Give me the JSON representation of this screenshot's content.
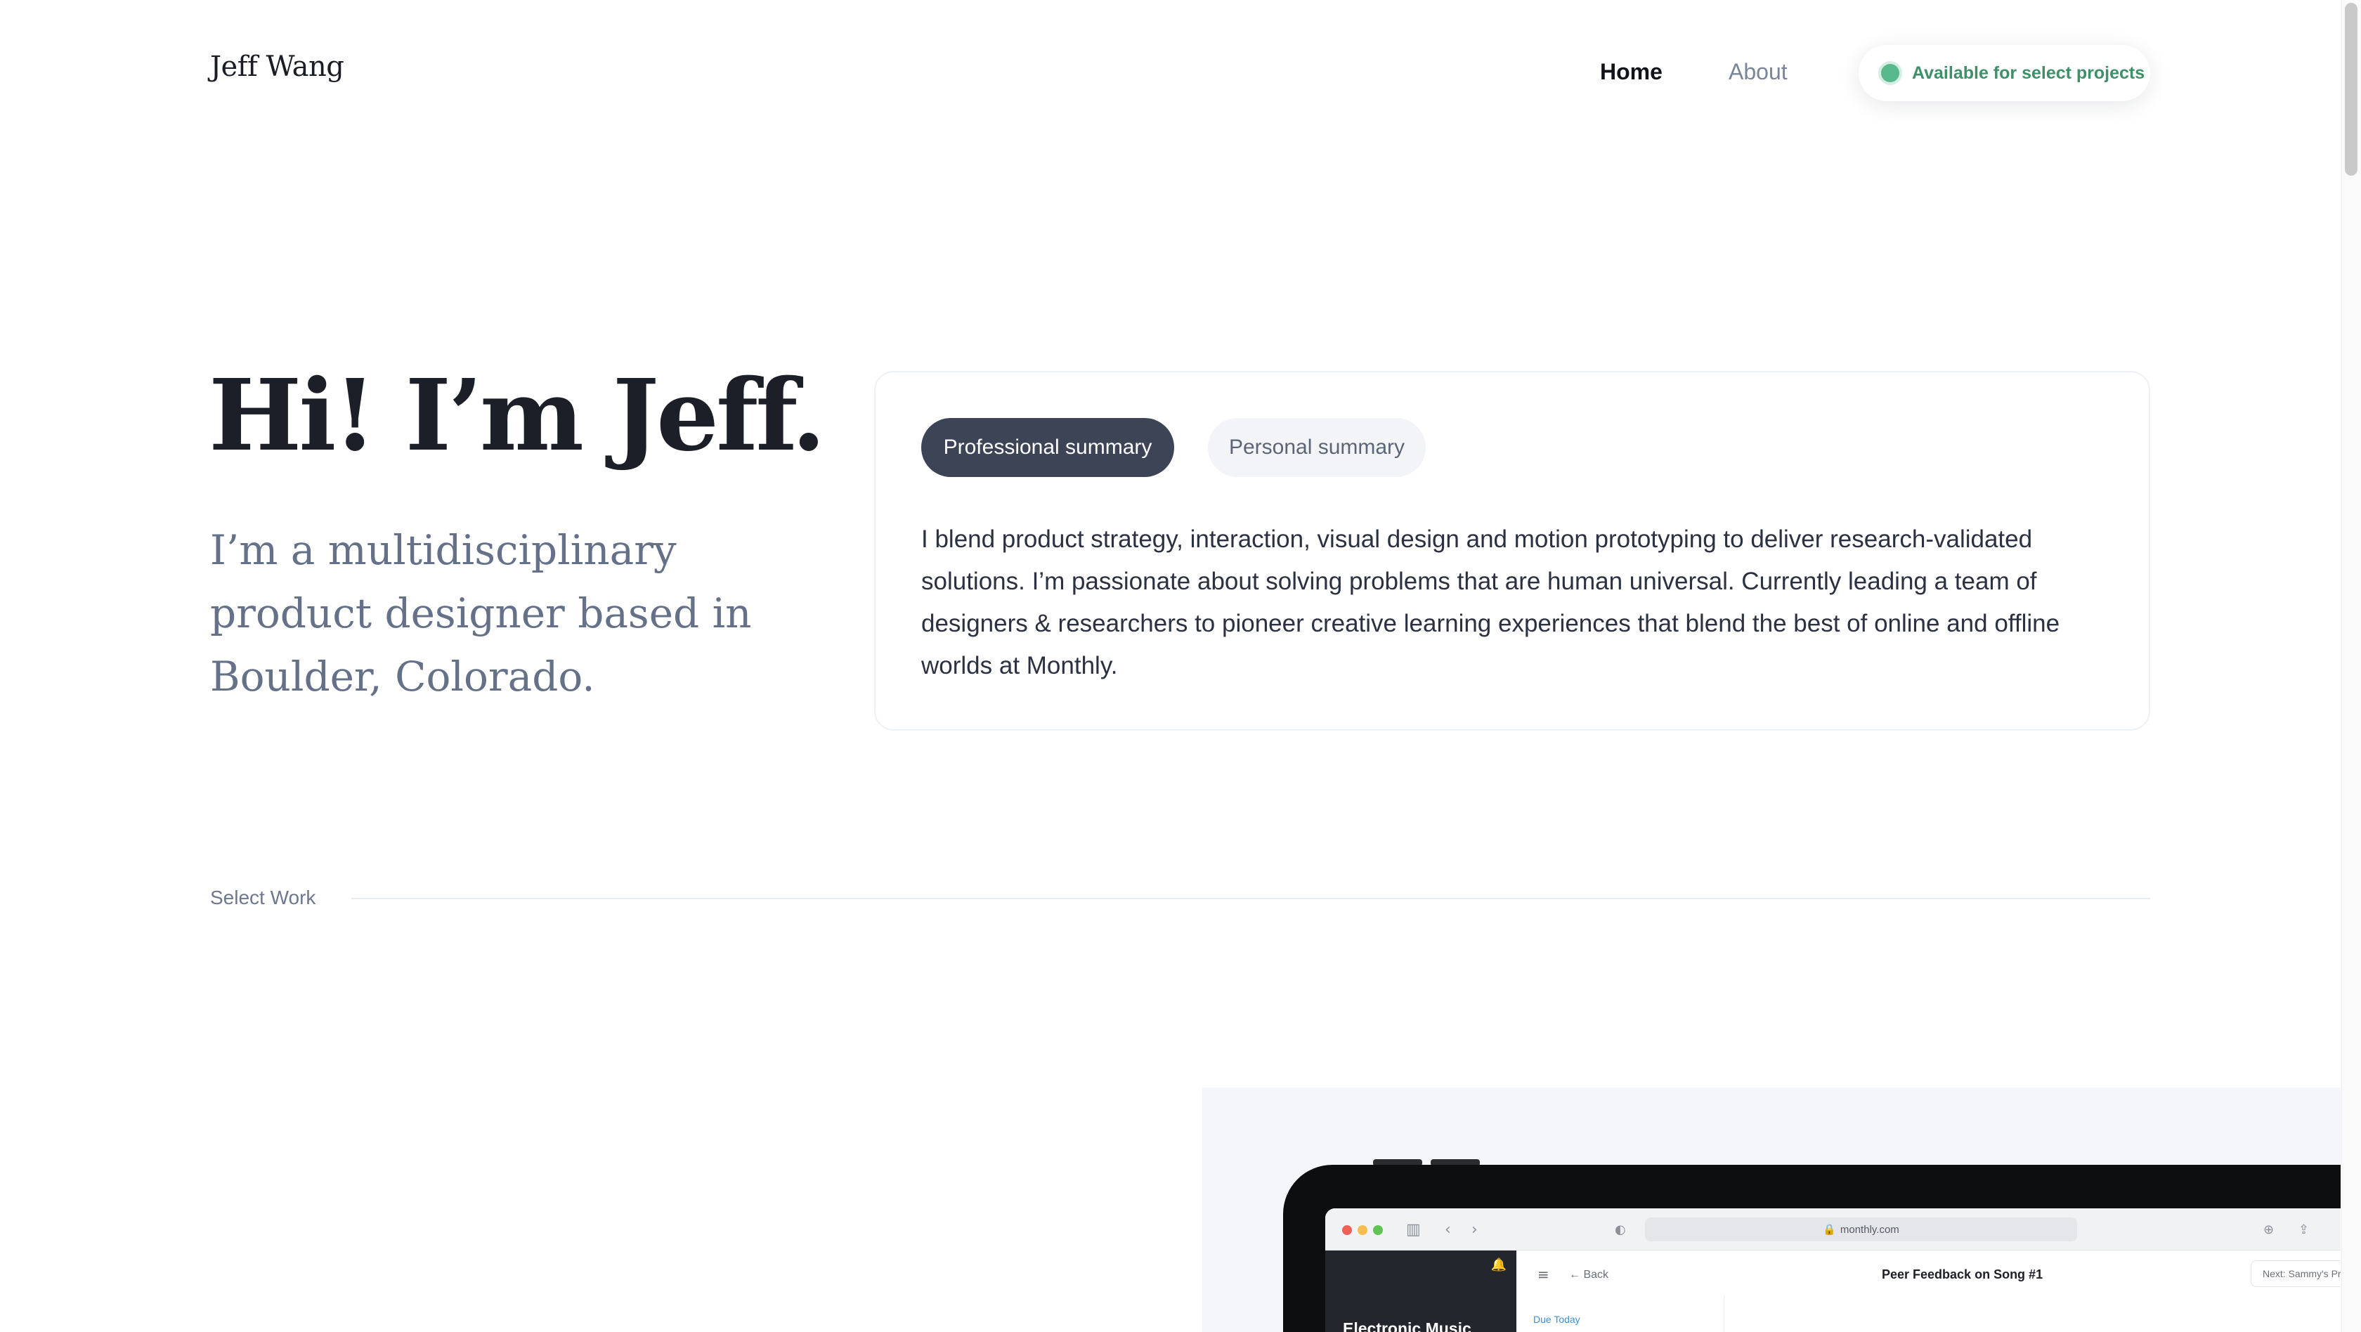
{
  "header": {
    "logo": "Jeff Wang",
    "nav": [
      {
        "label": "Home",
        "active": true
      },
      {
        "label": "About",
        "active": false
      }
    ],
    "availability": {
      "label": "Available for select projects",
      "dot_color": "#57b88d"
    }
  },
  "hero": {
    "title": "Hi! I’m Jeff.",
    "subtitle": "I’m a multidisciplinary product designer based in Boulder, Colorado."
  },
  "summary_card": {
    "tabs": [
      {
        "label": "Professional summary",
        "selected": true
      },
      {
        "label": "Personal summary",
        "selected": false
      }
    ],
    "text": "I blend product strategy, interaction, visual design and motion prototyping to deliver research-validated solutions. I’m passionate about solving problems that are human universal. Currently leading a team of designers & researchers to pioneer creative learning experiences that blend the best of online and offline worlds at Monthly."
  },
  "work": {
    "section_label": "Select Work",
    "preview": {
      "url": "monthly.com",
      "sidebar_title": "Electronic Music",
      "back_label": "Back",
      "page_title": "Peer Feedback on Song #1",
      "next_label": "Next: Sammy's Proje",
      "due_label": "Due Today"
    }
  },
  "colors": {
    "accent_dark": "#3c4456",
    "available_green": "#3f8f68",
    "muted_text": "#657089"
  }
}
